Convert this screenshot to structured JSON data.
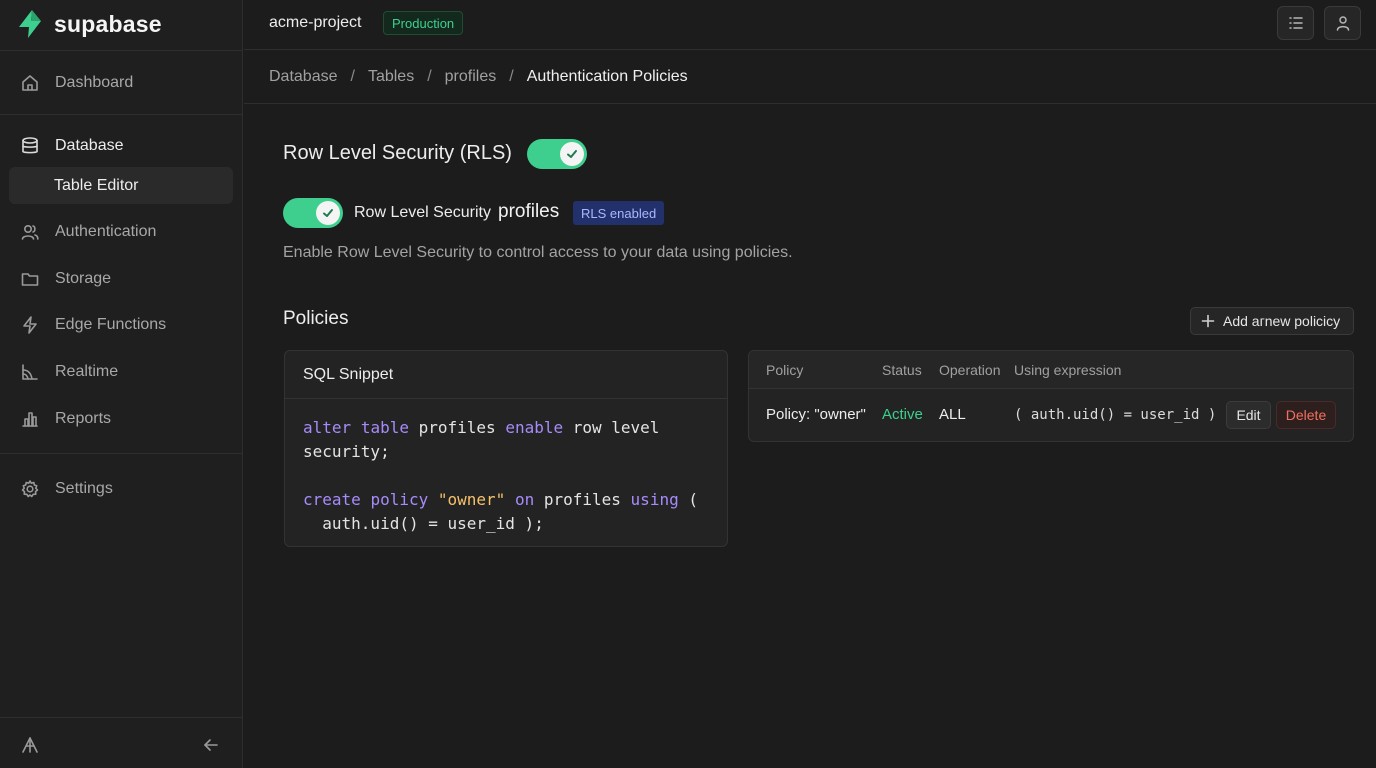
{
  "app": {
    "brand": "supabase",
    "accent": "#3ecf8e"
  },
  "header": {
    "project": "acme-project",
    "environment": "Production",
    "buttons": [
      "list-icon",
      "user-icon"
    ]
  },
  "sidebar": {
    "items": [
      {
        "label": "Dashboard",
        "icon": "home-icon"
      },
      {
        "label": "Database",
        "icon": "database-icon",
        "active": true,
        "sub_items": [
          {
            "label": "Table Editor",
            "selected": true
          }
        ]
      },
      {
        "label": "Authentication",
        "icon": "users-icon"
      },
      {
        "label": "Storage",
        "icon": "folder-icon"
      },
      {
        "label": "Edge Functions",
        "icon": "bolt-icon"
      },
      {
        "label": "Realtime",
        "icon": "realtime-icon"
      },
      {
        "label": "Reports",
        "icon": "bar-chart-icon"
      },
      {
        "label": "Settings",
        "icon": "gear-icon"
      }
    ],
    "bottom": {
      "left_icon": "ai-assistant-icon",
      "right_icon": "collapse-arrow-icon"
    }
  },
  "breadcrumb": [
    "Database",
    "Tables",
    "profiles",
    "Authentication Policies"
  ],
  "rls": {
    "title": "Row Level Security (RLS)",
    "enabled": true,
    "row_label": "Row Level Security",
    "table": "profiles",
    "badge": "RLS enabled",
    "description": "Enable Row Level Security to control access to your data using policies."
  },
  "policies": {
    "title": "Policies",
    "add_button": "Add aгnew policicy",
    "sql_snippet": {
      "title": "SQL Snippet",
      "lines": [
        "alter table profiles enable row level",
        "security;",
        "",
        "create policy \"owner\" on profiles using (",
        "  auth.uid() = user_id );"
      ]
    },
    "table": {
      "columns": [
        "Policy",
        "Status",
        "Operation",
        "Using expression"
      ],
      "rows": [
        {
          "policy": "Policy: \"owner\"",
          "status": "Active",
          "operation": "ALL",
          "expression": "( auth.uid() = user_id )",
          "actions": [
            "Edit",
            "Delete"
          ]
        }
      ]
    }
  }
}
